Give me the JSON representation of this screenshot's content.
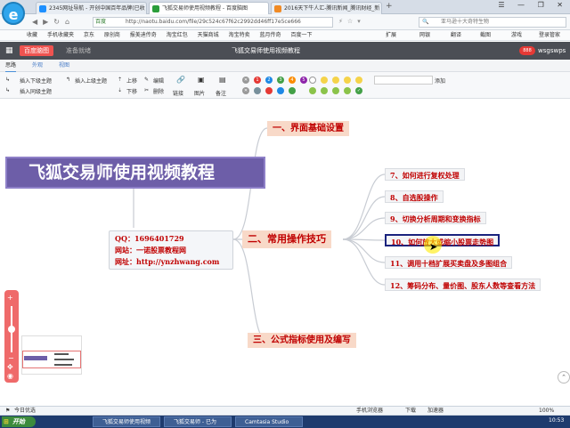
{
  "browser": {
    "tabs": [
      {
        "label": "2345网址导航 - 开创中国百年品牌(已收",
        "active": false,
        "color": "#1e90ff"
      },
      {
        "label": "飞狐交易师使用视频教程 - 百度脑图",
        "active": true,
        "color": "#2a9d3a"
      },
      {
        "label": "2016天下牛人汇-腾讯新闻_腾讯财经_新",
        "active": false,
        "color": "#f08a24"
      }
    ],
    "window_controls": "☰ — ❐ ✕",
    "address_mode": "百度",
    "url": "http://naotu.baidu.com/file/29c524c67f62c2992dd46ff17e5ce666",
    "search_placeholder": "亚马逊十大奇特生物",
    "bookmarks": [
      "收藏",
      "手机收藏夹",
      "京东",
      "原创商",
      "报美迪传奇",
      "淘宝红包",
      "天猫商城",
      "淘宝特卖",
      "蓝月传奇",
      "百度一下"
    ],
    "right_tools": [
      "扩展",
      "网银",
      "翻译",
      "截图",
      "游戏",
      "登录管家"
    ]
  },
  "app": {
    "brand": "百度脑图",
    "status": "准备就绪",
    "title": "飞狐交易师使用视频教程",
    "user": "wsgswps",
    "user_badge": "888"
  },
  "menu": {
    "items": [
      "思路",
      "外观",
      "视图"
    ]
  },
  "ribbon": {
    "insert_child": "插入下级主题",
    "insert_parent": "插入上级主题",
    "insert_sibling": "插入同级主题",
    "move_up": "上移",
    "move_down": "下移",
    "edit": "编辑",
    "delete": "删除",
    "link": "链接",
    "image": "图片",
    "note": "备注",
    "add": "添加",
    "priority": [
      "1",
      "2",
      "3",
      "4",
      "5"
    ]
  },
  "mindmap": {
    "root": "飞狐交易师使用视频教程",
    "info": {
      "qq_label": "QQ：",
      "qq": "1696401729",
      "site_label": "网站：",
      "site": "一诺股票教程网",
      "url_label": "网址：",
      "url": "http://ynzhwang.com"
    },
    "branches": [
      "一、界面基础设置",
      "二、常用操作技巧",
      "三、公式指标使用及编写"
    ],
    "subtopics": [
      "7、如何进行复权处理",
      "8、自选股操作",
      "9、切换分析周期和变换指标",
      "10、如何放大或缩小股票走势图",
      "11、调用十档扩展买卖盘及多图组合",
      "12、筹码分布、量价图、股东人数等查看方法"
    ],
    "selected_index": 3
  },
  "zoom": {
    "plus": "+",
    "minus": "−"
  },
  "statusbar": {
    "today": "今日优选",
    "right": [
      "手机浏览器",
      "下载",
      "加速器",
      "100%"
    ]
  },
  "taskbar": {
    "start": "开始",
    "items": [
      "飞狐交易师使用视频",
      "飞狐交易师 - 已为",
      "Camtasia Studio"
    ],
    "clock": "10:53"
  }
}
